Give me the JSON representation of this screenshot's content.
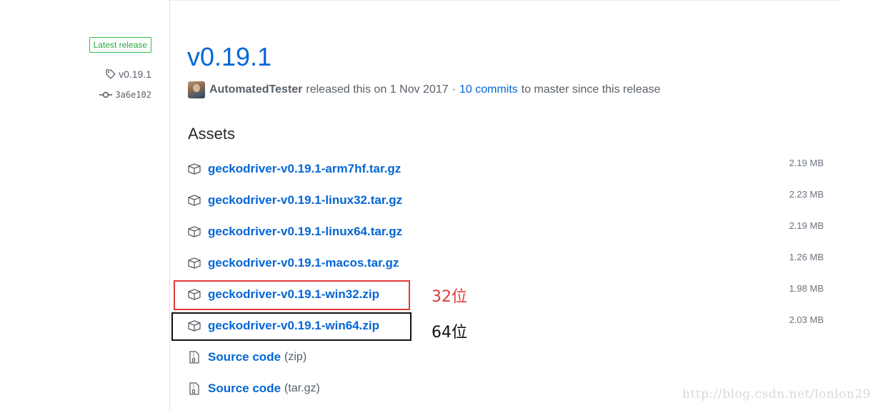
{
  "sidebar": {
    "badge": "Latest release",
    "tag": "v0.19.1",
    "commit": "3a6e102"
  },
  "release": {
    "title": "v0.19.1",
    "author": "AutomatedTester",
    "released_text": "released this on 1 Nov 2017",
    "separator": "·",
    "commits_link": "10 commits",
    "commits_suffix": "to master since this release"
  },
  "assets": {
    "heading": "Assets",
    "files": [
      {
        "name": "geckodriver-v0.19.1-arm7hf.tar.gz",
        "size": "2.19 MB"
      },
      {
        "name": "geckodriver-v0.19.1-linux32.tar.gz",
        "size": "2.23 MB"
      },
      {
        "name": "geckodriver-v0.19.1-linux64.tar.gz",
        "size": "2.19 MB"
      },
      {
        "name": "geckodriver-v0.19.1-macos.tar.gz",
        "size": "1.26 MB"
      },
      {
        "name": "geckodriver-v0.19.1-win32.zip",
        "size": "1.98 MB"
      },
      {
        "name": "geckodriver-v0.19.1-win64.zip",
        "size": "2.03 MB"
      }
    ],
    "source": [
      {
        "name": "Source code",
        "suffix": "(zip)"
      },
      {
        "name": "Source code",
        "suffix": "(tar.gz)"
      }
    ]
  },
  "annotations": {
    "win32_note": "32位",
    "win64_note": "64位",
    "red_color": "#e03b3b",
    "black_color": "#111111"
  },
  "watermark": "http://blog.csdn.net/lonlon29",
  "colors": {
    "link": "#0366d6",
    "badge_green": "#28a745",
    "muted": "#586069"
  },
  "icons": {
    "tag": "tag-icon",
    "commit": "git-commit-icon",
    "package": "package-icon",
    "file_zip": "file-zip-icon"
  }
}
